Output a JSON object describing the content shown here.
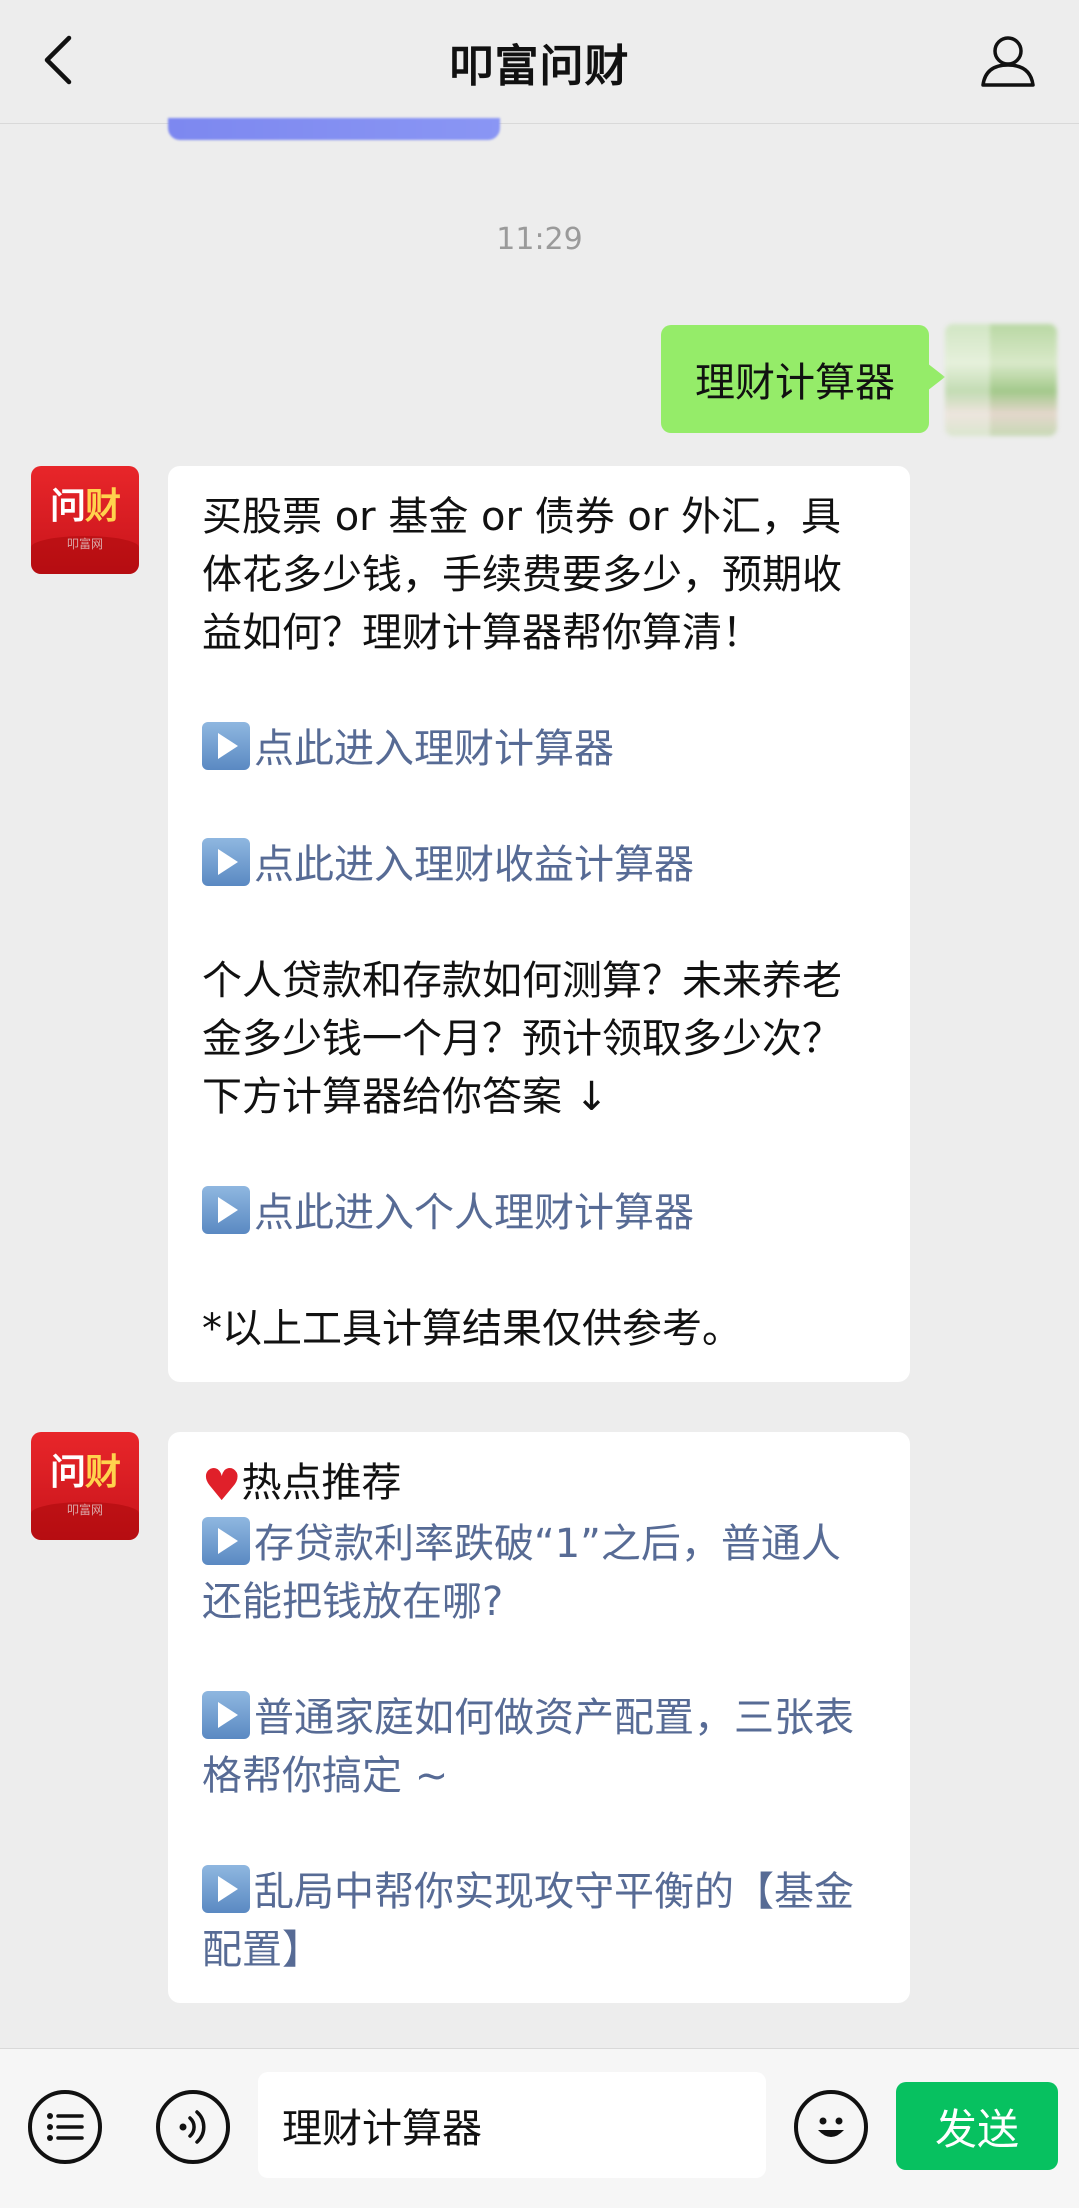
{
  "header": {
    "title": "叩富问财",
    "back_icon": "chevron-left-icon",
    "profile_icon": "person-icon"
  },
  "chat": {
    "timestamp": "11:29",
    "user_message": "理财计算器",
    "bot_logo": {
      "main_left": "问",
      "main_right": "财",
      "sub": "叩富网"
    },
    "message1": {
      "intro": "买股票 or 基金 or 债券 or 外汇，具体花多少钱，手续费要多少，预期收益如何？理财计算器帮你算清！",
      "link1": "点此进入理财计算器",
      "link2": "点此进入理财收益计算器",
      "para2": "个人贷款和存款如何测算？未来养老金多少钱一个月？预计领取多少次？下方计算器给你答案 ↓",
      "link3": "点此进入个人理财计算器",
      "footnote": "*以上工具计算结果仅供参考。"
    },
    "message2": {
      "heading": "热点推荐",
      "link1": "存贷款利率跌破“1”之后，普通人还能把钱放在哪?",
      "link2": "普通家庭如何做资产配置，三张表格帮你搞定 ~",
      "link3": "乱局中帮你实现攻守平衡的【基金配置】"
    }
  },
  "input_bar": {
    "menu_icon": "list-menu-icon",
    "voice_icon": "voice-icon",
    "input_value": "理财计算器",
    "emoji_icon": "emoji-icon",
    "send_label": "发送"
  },
  "colors": {
    "background": "#ededed",
    "user_bubble": "#95ec69",
    "link": "#576b95",
    "send_button": "#07c160",
    "brand_red": "#e8262a"
  }
}
